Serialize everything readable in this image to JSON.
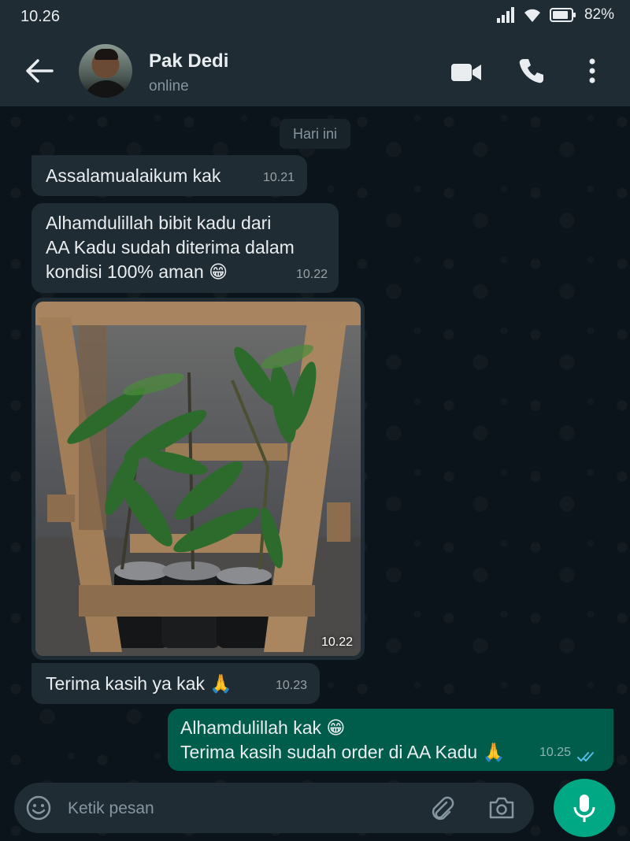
{
  "status_bar": {
    "time": "10.26",
    "battery": "82%"
  },
  "header": {
    "contact_name": "Pak Dedi",
    "contact_status": "online"
  },
  "date_divider": "Hari ini",
  "messages": [
    {
      "text": "Assalamualaikum kak",
      "time": "10.21"
    },
    {
      "text": "Alhamdulillah bibit kadu dari\nAA Kadu sudah diterima dalam\nkondisi 100% aman 😁",
      "time": "10.22"
    },
    {
      "image_time": "10.22"
    },
    {
      "text": "Terima kasih ya kak 🙏",
      "time": "10.23"
    },
    {
      "text": "Alhamdulillah kak 😁\nTerima kasih sudah order di AA Kadu 🙏",
      "time": "10.25"
    }
  ],
  "composer": {
    "placeholder": "Ketik pesan"
  },
  "colors": {
    "incoming_bubble": "#1f2c34",
    "outgoing_bubble": "#005c4b",
    "accent": "#00a884",
    "read_ticks": "#53bdeb"
  },
  "icons": [
    "back-arrow-icon",
    "video-call-icon",
    "phone-icon",
    "more-options-icon",
    "emoji-icon",
    "attachment-icon",
    "camera-icon",
    "microphone-icon",
    "double-check-icon"
  ]
}
